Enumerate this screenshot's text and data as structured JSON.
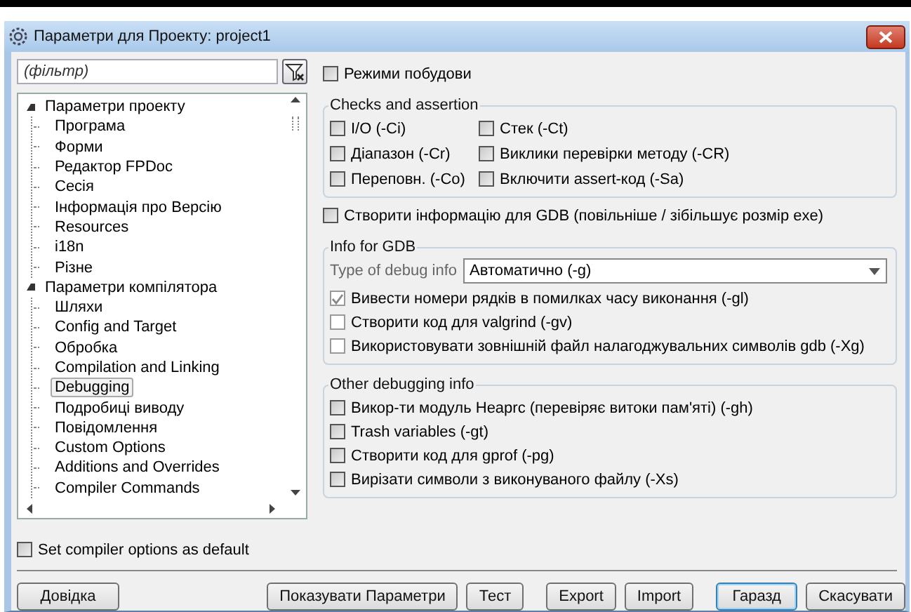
{
  "window": {
    "title": "Параметри для Проекту: project1"
  },
  "filter": {
    "placeholder": "(фільтр)"
  },
  "tree": [
    {
      "label": "Параметри проекту",
      "expanded": true,
      "selected": false,
      "children": [
        {
          "label": "Програма",
          "selected": false
        },
        {
          "label": "Форми",
          "selected": false
        },
        {
          "label": "Редактор FPDoc",
          "selected": false
        },
        {
          "label": "Сесія",
          "selected": false
        },
        {
          "label": "Інформація про Версію",
          "selected": false
        },
        {
          "label": "Resources",
          "selected": false
        },
        {
          "label": "i18n",
          "selected": false
        },
        {
          "label": "Різне",
          "selected": false
        }
      ]
    },
    {
      "label": "Параметри компілятора",
      "expanded": true,
      "selected": false,
      "children": [
        {
          "label": "Шляхи",
          "selected": false
        },
        {
          "label": "Config and Target",
          "selected": false
        },
        {
          "label": "Обробка",
          "selected": false
        },
        {
          "label": "Compilation and Linking",
          "selected": false
        },
        {
          "label": "Debugging",
          "selected": true
        },
        {
          "label": "Подробиці виводу",
          "selected": false
        },
        {
          "label": "Повідомлення",
          "selected": false
        },
        {
          "label": "Custom Options",
          "selected": false
        },
        {
          "label": "Additions and Overrides",
          "selected": false
        },
        {
          "label": "Compiler Commands",
          "selected": false
        }
      ]
    }
  ],
  "default_checkbox": {
    "label": "Set compiler options as default",
    "checked": false
  },
  "build_modes": {
    "label": "Режими побудови",
    "checked": false
  },
  "checks_group": {
    "title": "Checks and assertion",
    "options": [
      {
        "label": "I/O (-Ci)",
        "checked": false
      },
      {
        "label": "Стек (-Ct)",
        "checked": false
      },
      {
        "label": "Діапазон (-Cr)",
        "checked": false
      },
      {
        "label": "Виклики перевірки методу (-CR)",
        "checked": false
      },
      {
        "label": "Переповн. (-Co)",
        "checked": false
      },
      {
        "label": "Включити assert-код (-Sa)",
        "checked": false
      }
    ]
  },
  "gdb_checkbox": {
    "label": "Створити інформацію для GDB (повільніше / зібільшує розмір exe)",
    "checked": false
  },
  "gdb_group": {
    "title": "Info for GDB",
    "type_label": "Type of debug info",
    "type_value": "Автоматично (-g)",
    "options": [
      {
        "label": "Вивести номери рядків в помилках часу виконання (-gl)",
        "checked": true,
        "disabled": true
      },
      {
        "label": "Створити код для valgrind (-gv)",
        "checked": false,
        "disabled": true
      },
      {
        "label": "Використовувати зовнішній файл налагоджувальних символів gdb (-Xg)",
        "checked": false,
        "disabled": true
      }
    ]
  },
  "other_group": {
    "title": "Other debugging info",
    "options": [
      {
        "label": "Викор-ти модуль Heaprc (перевіряє витоки пам'яті) (-gh)",
        "checked": false
      },
      {
        "label": "Trash variables (-gt)",
        "checked": false
      },
      {
        "label": "Створити код для gprof (-pg)",
        "checked": false
      },
      {
        "label": "Вирізати символи з виконуваного файлу (-Xs)",
        "checked": false
      }
    ]
  },
  "buttons": [
    {
      "label": "Довідка",
      "default": false
    },
    {
      "label": "Показувати Параметри",
      "default": false
    },
    {
      "label": "Тест",
      "default": false
    },
    {
      "label": "Export",
      "default": false
    },
    {
      "label": "Import",
      "default": false
    },
    {
      "label": "Гаразд",
      "default": true
    },
    {
      "label": "Скасувати",
      "default": false
    }
  ]
}
